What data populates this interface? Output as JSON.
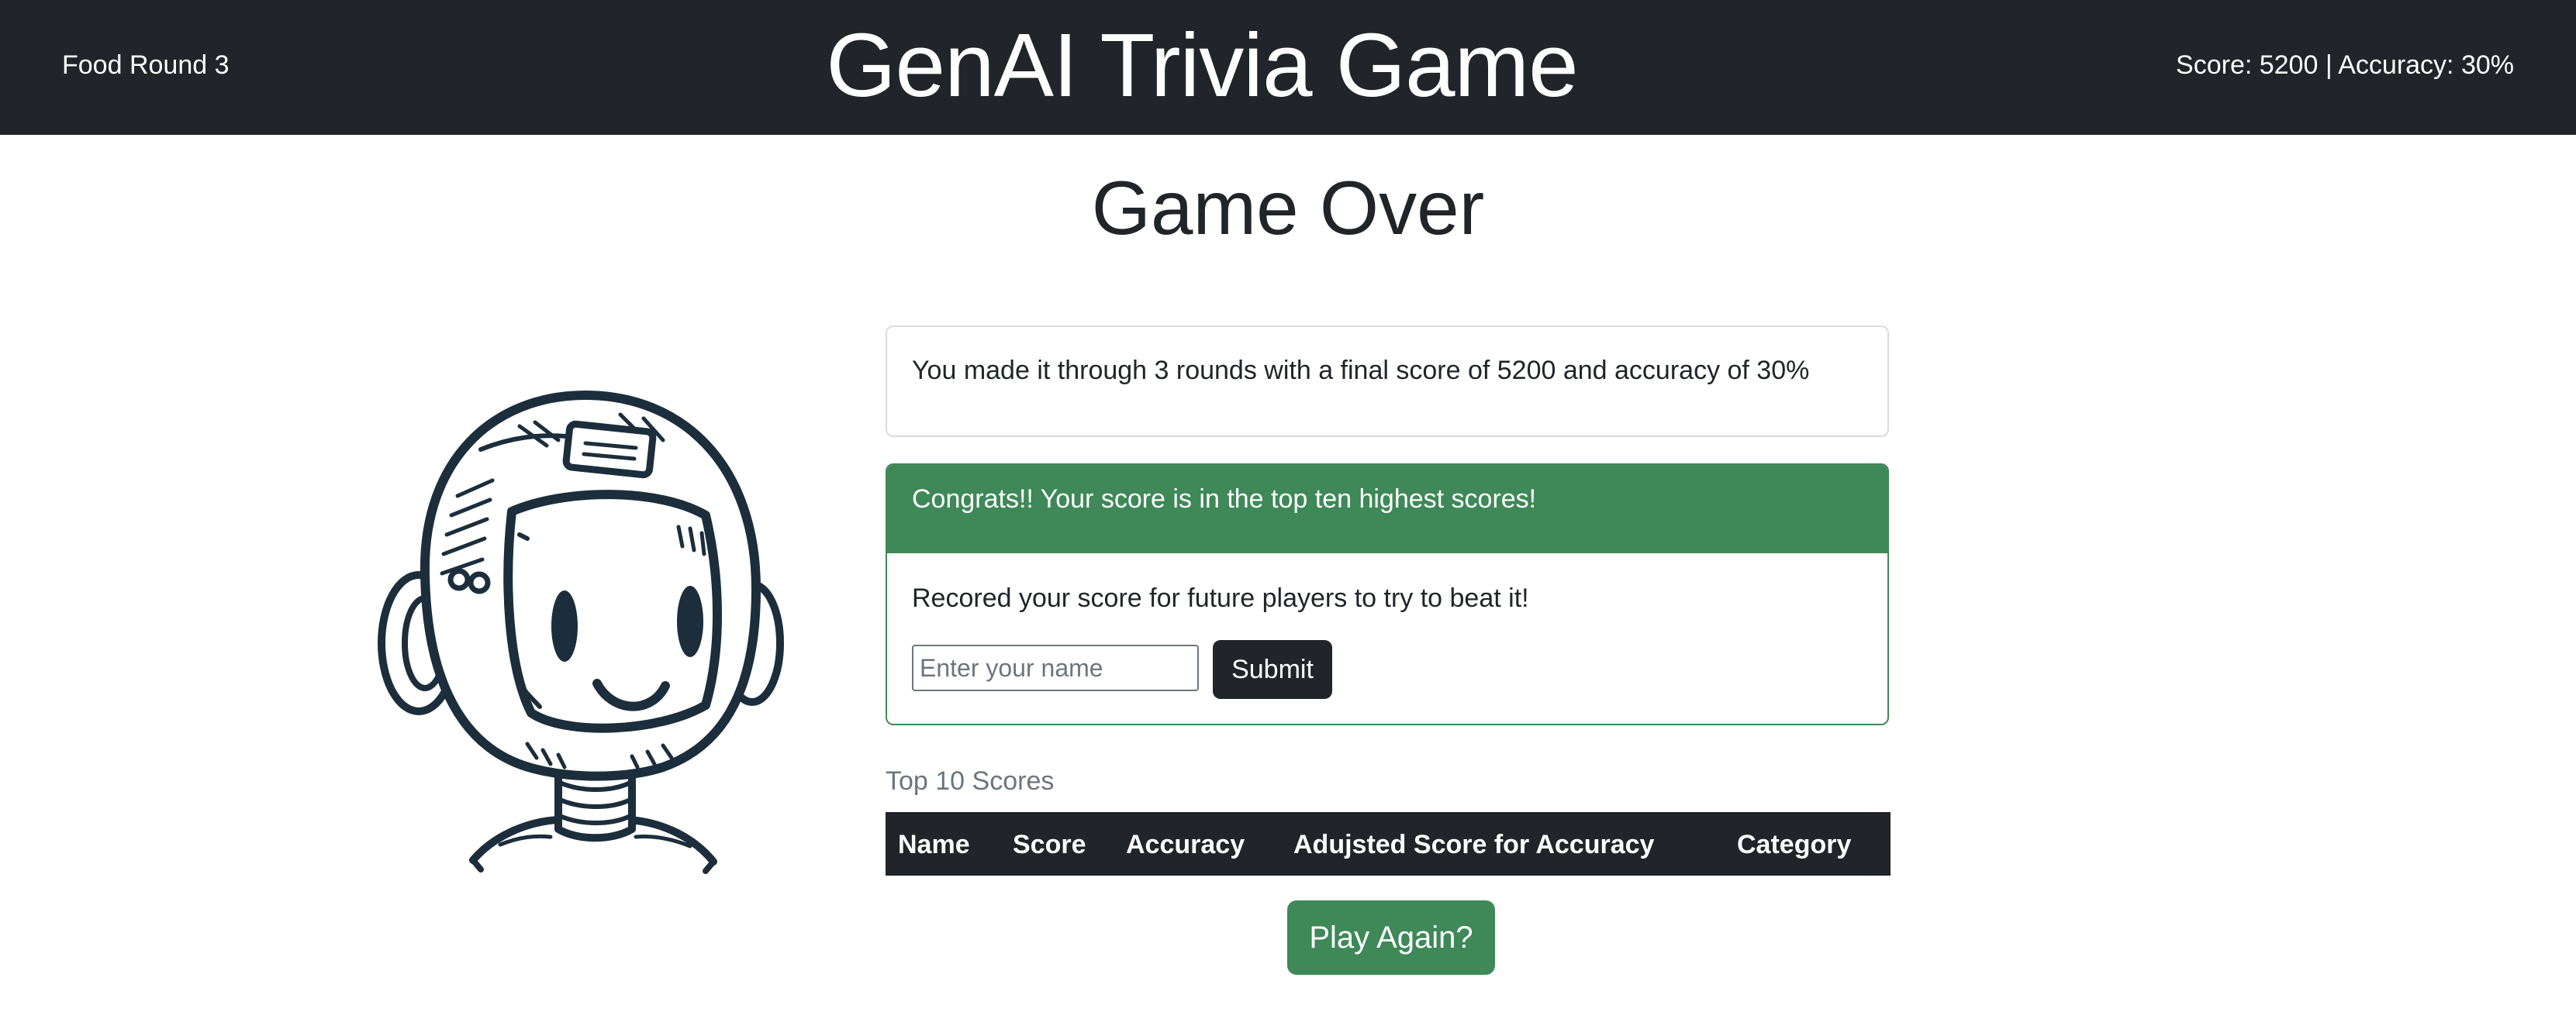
{
  "navbar": {
    "round_label": "Food Round 3",
    "title": "GenAI Trivia Game",
    "stats": "Score: 5200 | Accuracy: 30%",
    "background_color": "#212529"
  },
  "page": {
    "title": "Game Over"
  },
  "summary_card": {
    "text": "You made it through 3 rounds with a final score of 5200 and accuracy of 30%"
  },
  "congrats_card": {
    "header": "Congrats!! Your score is in the top ten highest scores!",
    "body": "Recored your score for future players to try to beat it!",
    "name_input": {
      "value": "",
      "placeholder": "Enter your name"
    },
    "submit_label": "Submit",
    "accent_color": "#3f8858"
  },
  "scores": {
    "caption": "Top 10 Scores",
    "columns": [
      "Name",
      "Score",
      "Accuracy",
      "Adujsted Score for Accuracy",
      "Category"
    ],
    "rows": []
  },
  "actions": {
    "play_again_label": "Play Again?"
  },
  "mascot": {
    "icon": "astronaut-robot-mascot"
  }
}
